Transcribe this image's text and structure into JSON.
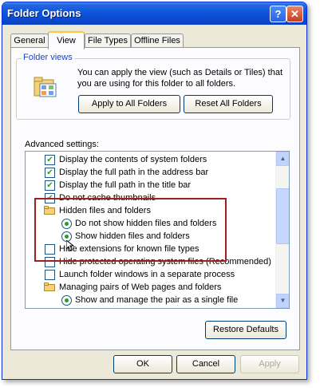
{
  "window": {
    "title": "Folder Options"
  },
  "tabs": [
    "General",
    "View",
    "File Types",
    "Offline Files"
  ],
  "folder_views": {
    "label": "Folder views",
    "description": "You can apply the view (such as Details or Tiles) that you are using for this folder to all folders.",
    "apply_button": "Apply to All Folders",
    "reset_button": "Reset All Folders"
  },
  "advanced": {
    "label": "Advanced settings:",
    "items": [
      "Display the contents of system folders",
      "Display the full path in the address bar",
      "Display the full path in the title bar",
      "Do not cache thumbnails",
      "Hidden files and folders",
      "Do not show hidden files and folders",
      "Show hidden files and folders",
      "Hide extensions for known file types",
      "Hide protected operating system files (Recommended)",
      "Launch folder windows in a separate process",
      "Managing pairs of Web pages and folders",
      "Show and manage the pair as a single file"
    ]
  },
  "buttons": {
    "restore": "Restore Defaults",
    "ok": "OK",
    "cancel": "Cancel",
    "apply": "Apply"
  }
}
